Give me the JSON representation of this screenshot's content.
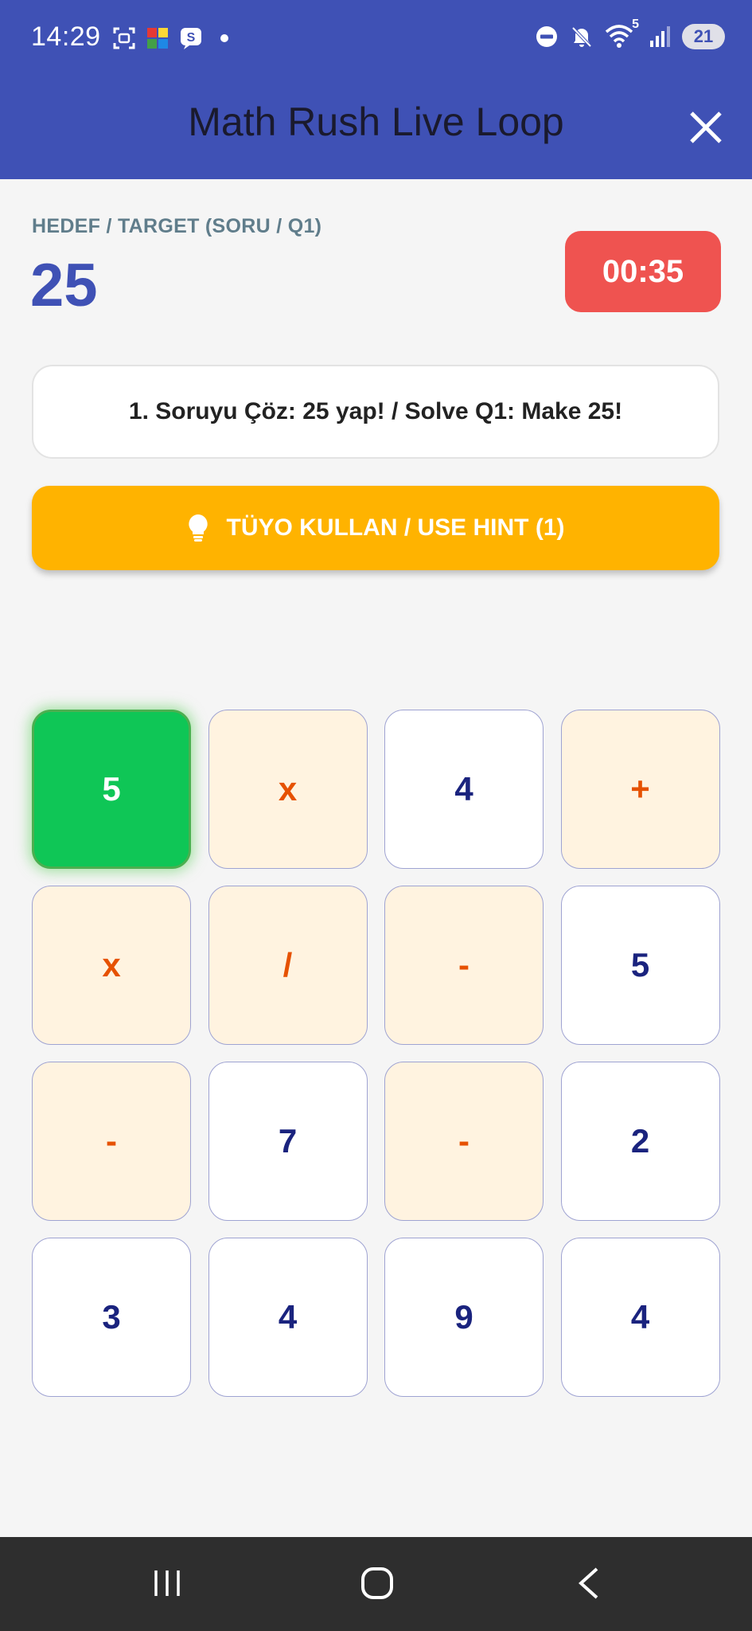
{
  "status_bar": {
    "time": "14:29",
    "wifi_badge": "5",
    "battery": "21",
    "icons": [
      "screenshot-icon",
      "app-icon",
      "messenger-icon",
      "notification-dot-icon",
      "do-not-disturb-icon",
      "mute-icon",
      "wifi-icon",
      "signal-icon",
      "battery-icon"
    ]
  },
  "app_bar": {
    "title": "Math Rush Live Loop",
    "close_icon": "close-icon"
  },
  "game": {
    "target_label": "HEDEF / TARGET (SORU / Q1)",
    "target_value": "25",
    "timer": "00:35",
    "message": "1. Soruyu Çöz: 25 yap! / Solve Q1: Make 25!",
    "hint_label": "TÜYO KULLAN / USE HINT (1)",
    "hint_icon": "lightbulb-icon"
  },
  "tiles": [
    {
      "label": "5",
      "kind": "num",
      "selected": true
    },
    {
      "label": "x",
      "kind": "op"
    },
    {
      "label": "4",
      "kind": "num"
    },
    {
      "label": "+",
      "kind": "op"
    },
    {
      "label": "x",
      "kind": "op"
    },
    {
      "label": "/",
      "kind": "op"
    },
    {
      "label": "-",
      "kind": "op"
    },
    {
      "label": "5",
      "kind": "num"
    },
    {
      "label": "-",
      "kind": "op"
    },
    {
      "label": "7",
      "kind": "num"
    },
    {
      "label": "-",
      "kind": "op"
    },
    {
      "label": "2",
      "kind": "num"
    },
    {
      "label": "3",
      "kind": "num"
    },
    {
      "label": "4",
      "kind": "num"
    },
    {
      "label": "9",
      "kind": "num"
    },
    {
      "label": "4",
      "kind": "num"
    }
  ],
  "colors": {
    "primary": "#3f51b5",
    "timer": "#ef5350",
    "hint": "#ffb300",
    "selected_tile": "#0fc656",
    "operator_tile": "#fff3e0",
    "operator_text": "#e65100",
    "number_text": "#1a237e"
  },
  "nav_bar": {
    "icons": [
      "recents-icon",
      "home-icon",
      "back-icon"
    ]
  }
}
